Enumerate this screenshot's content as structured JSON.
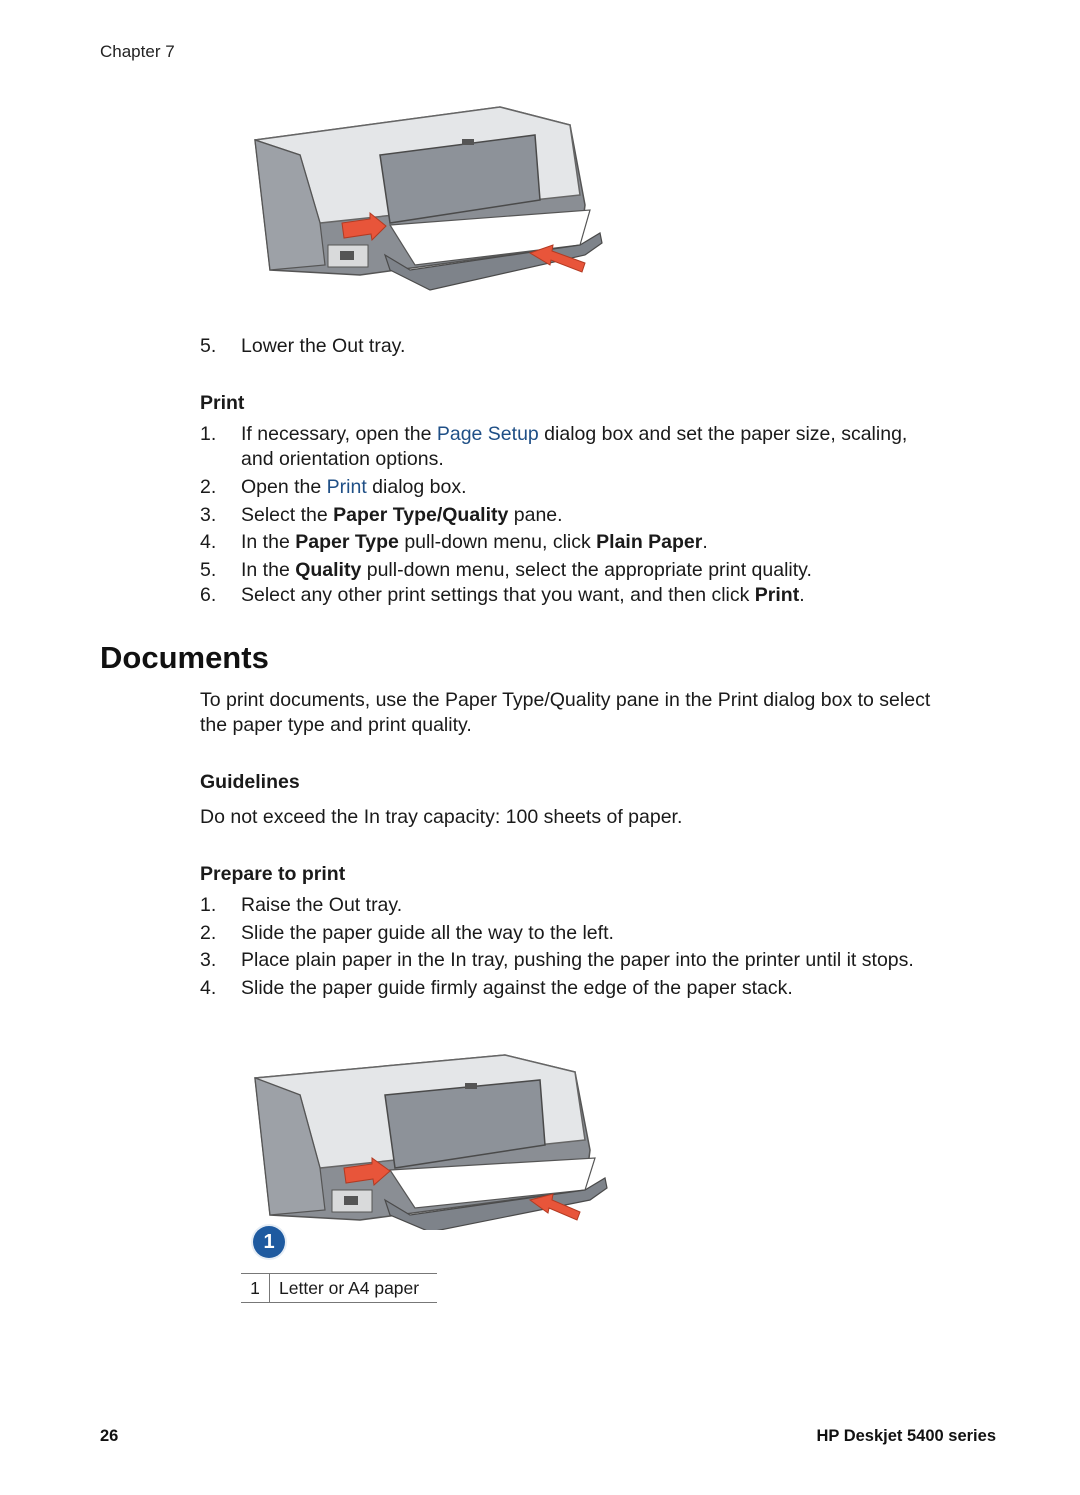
{
  "header": {
    "chapter": "Chapter 7"
  },
  "figure_top": {
    "description": "printer with Out tray lowered and paper loaded",
    "arrow_color": "#e8553a"
  },
  "step_lower": {
    "num": "5.",
    "text": "Lower the Out tray."
  },
  "print_section": {
    "heading": "Print",
    "steps": [
      {
        "num": "1.",
        "pre": "If necessary, open the ",
        "link": "Page Setup",
        "post": " dialog box and set the paper size, scaling,",
        "line2": "and orientation options."
      },
      {
        "num": "2.",
        "pre": "Open the ",
        "link": "Print",
        "post": " dialog box."
      },
      {
        "num": "3.",
        "pre": "Select the ",
        "bold": "Paper Type/Quality",
        "post": " pane."
      },
      {
        "num": "4.",
        "pre": "In the ",
        "bold": "Paper Type",
        "mid": " pull-down menu, click ",
        "bold2": "Plain Paper",
        "post": "."
      },
      {
        "num": "5.",
        "pre": "In the ",
        "bold": "Quality",
        "post": " pull-down menu, select the appropriate print quality."
      },
      {
        "num": "6.",
        "pre": "Select any other print settings that you want, and then click ",
        "bold": "Print",
        "post": "."
      }
    ]
  },
  "documents": {
    "title": "Documents",
    "intro_line1": "To print documents, use the Paper Type/Quality pane in the Print dialog box to select",
    "intro_line2": "the paper type and print quality.",
    "guidelines_heading": "Guidelines",
    "guidelines_text": "Do not exceed the In tray capacity: 100 sheets of paper.",
    "prepare_heading": "Prepare to print",
    "prepare_steps": [
      {
        "num": "1.",
        "text": "Raise the Out tray."
      },
      {
        "num": "2.",
        "text": "Slide the paper guide all the way to the left."
      },
      {
        "num": "3.",
        "text": "Place plain paper in the In tray, pushing the paper into the printer until it stops."
      },
      {
        "num": "4.",
        "text": "Slide the paper guide firmly against the edge of the paper stack."
      }
    ]
  },
  "figure_bottom": {
    "callout_number": "1",
    "legend": [
      {
        "num": "1",
        "label": "Letter or A4 paper"
      }
    ]
  },
  "colors": {
    "link": "#1f4f86",
    "callout": "#1e5aa0",
    "arrow": "#e8553a"
  },
  "footer": {
    "page_number": "26",
    "product": "HP Deskjet 5400 series"
  }
}
